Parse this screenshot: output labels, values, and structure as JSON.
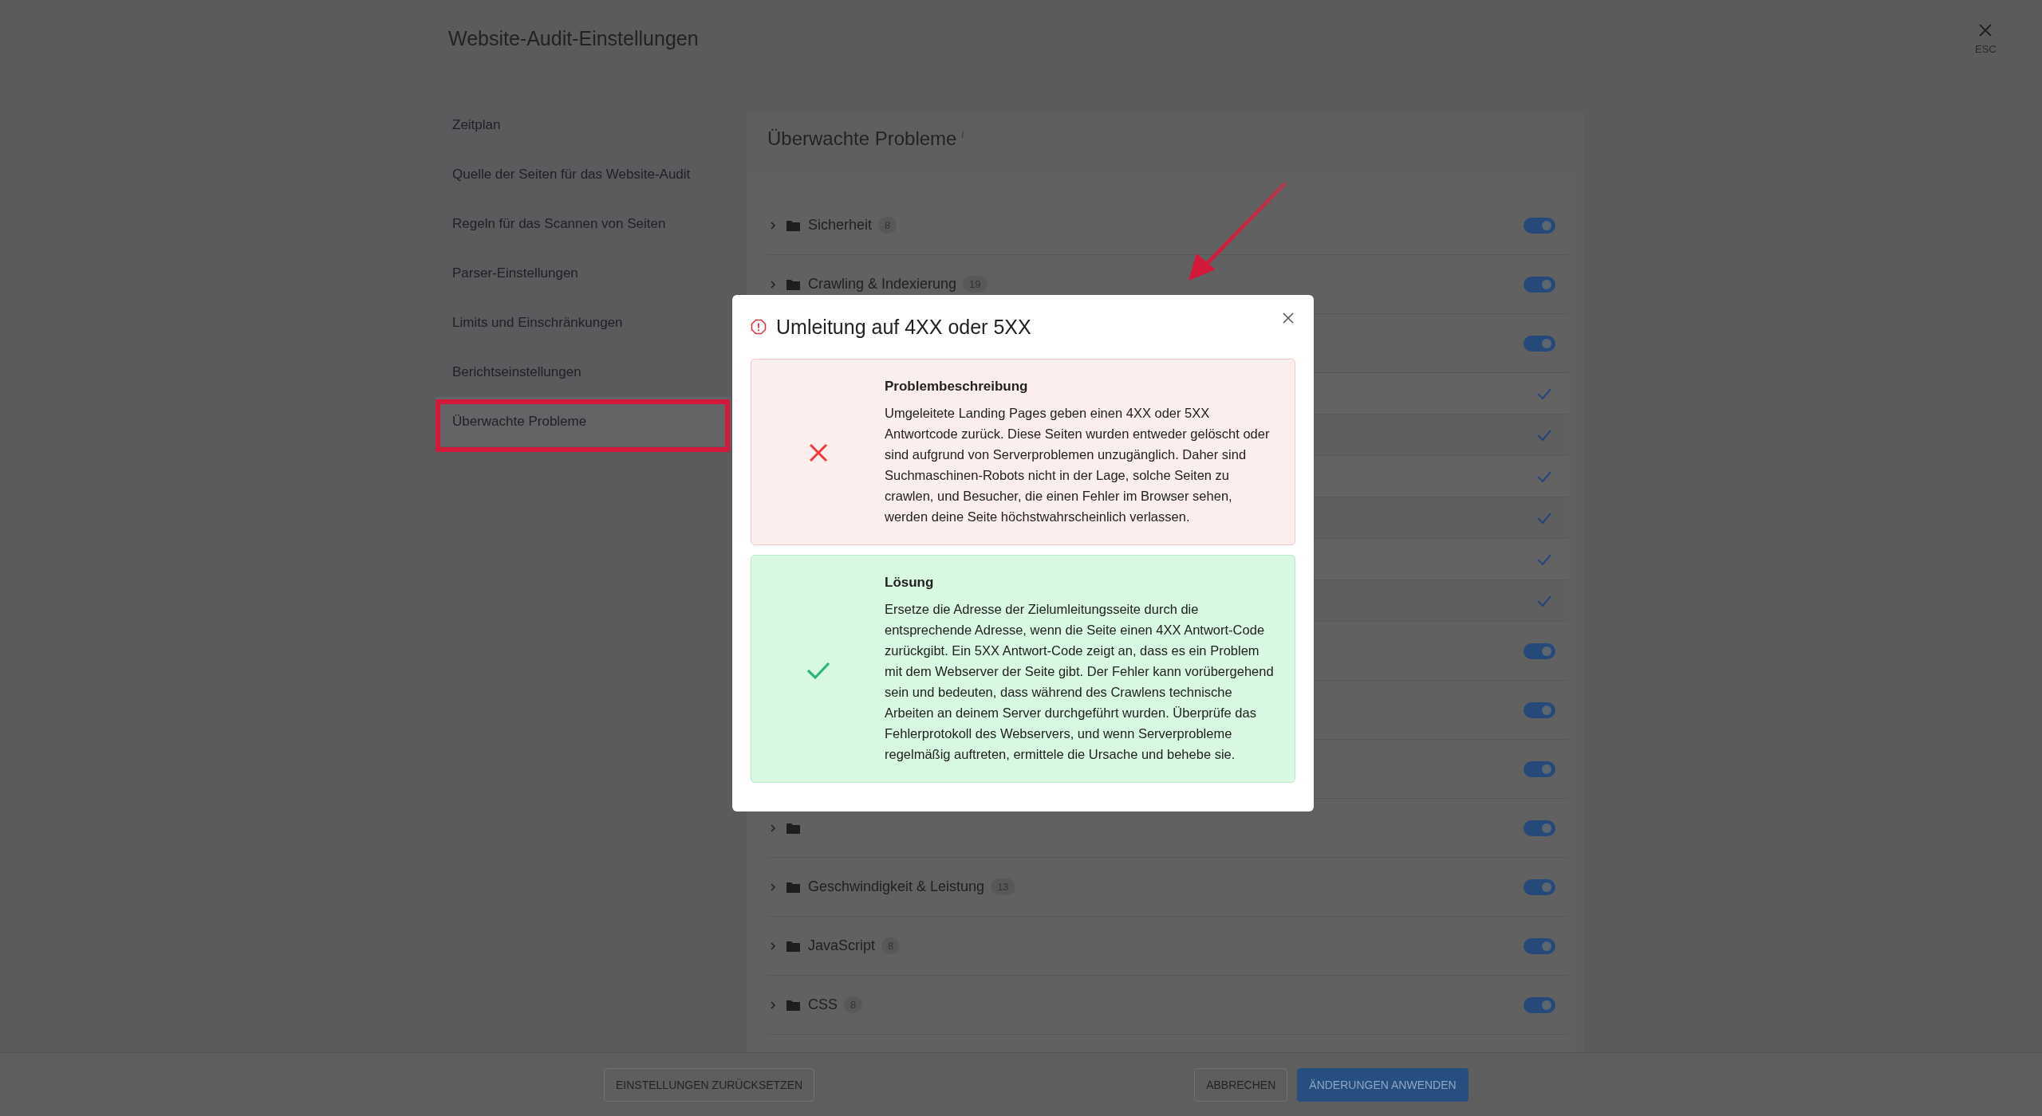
{
  "dialog_title": "Website-Audit-Einstellungen",
  "close_label": "ESC",
  "sidebar": {
    "items": [
      {
        "label": "Zeitplan",
        "selected": false
      },
      {
        "label": "Quelle der Seiten für das Website-Audit",
        "selected": false
      },
      {
        "label": "Regeln für das Scannen von Seiten",
        "selected": false
      },
      {
        "label": "Parser-Einstellungen",
        "selected": false
      },
      {
        "label": "Limits und Einschränkungen",
        "selected": false
      },
      {
        "label": "Berichtseinstellungen",
        "selected": false
      },
      {
        "label": "Überwachte Probleme",
        "selected": true
      }
    ]
  },
  "panel": {
    "title": "Überwachte Probleme",
    "info_mark": "i",
    "rows": [
      {
        "kind": "group",
        "label": "Sicherheit",
        "count": "8",
        "on": true
      },
      {
        "kind": "group",
        "label": "Crawling & Indexierung",
        "count": "19",
        "on": true
      },
      {
        "kind": "group",
        "on": true
      },
      {
        "kind": "issue",
        "checked": true
      },
      {
        "kind": "issue",
        "checked": true
      },
      {
        "kind": "issue",
        "checked": true
      },
      {
        "kind": "issue",
        "checked": true
      },
      {
        "kind": "issue",
        "checked": true
      },
      {
        "kind": "issue",
        "checked": true
      },
      {
        "kind": "group",
        "on": true
      },
      {
        "kind": "group",
        "on": true
      },
      {
        "kind": "group",
        "on": true
      },
      {
        "kind": "group",
        "on": true
      },
      {
        "kind": "group",
        "label": "Geschwindigkeit & Leistung",
        "count": "13",
        "on": true
      },
      {
        "kind": "group",
        "label": "JavaScript",
        "count": "8",
        "on": true
      },
      {
        "kind": "group",
        "label": "CSS",
        "count": "8",
        "on": true
      }
    ]
  },
  "modal": {
    "title": "Umleitung auf 4XX oder 5XX",
    "sections": [
      {
        "kind": "problem",
        "heading": "Problembeschreibung",
        "text": "Umgeleitete Landing Pages geben einen 4XX oder 5XX Antwortcode zurück. Diese Seiten wurden entweder gelöscht oder sind aufgrund von Serverproblemen unzugänglich. Daher sind Suchmaschinen-Robots nicht in der Lage, solche Seiten zu crawlen, und Besucher, die einen Fehler im Browser sehen, werden deine Seite höchstwahrscheinlich verlassen."
      },
      {
        "kind": "solution",
        "heading": "Lösung",
        "text": "Ersetze die Adresse der Zielumleitungsseite durch die entsprechende Adresse, wenn die Seite einen 4XX Antwort-Code zurückgibt. Ein 5XX Antwort-Code zeigt an, dass es ein Problem mit dem Webserver der Seite gibt. Der Fehler kann vorübergehend sein und bedeuten, dass während des Crawlens technische Arbeiten an deinem Server durchgeführt wurden. Überprüfe das Fehlerprotokoll des Webservers, und wenn Serverprobleme regelmäßig auftreten, ermittele die Ursache und behebe sie."
      }
    ]
  },
  "footer": {
    "buttons": [
      {
        "label": "EINSTELLUNGEN ZURÜCKSETZEN",
        "kind": "secondary"
      },
      {
        "label": "ABBRECHEN",
        "kind": "secondary"
      },
      {
        "label": "ÄNDERUNGEN ANWENDEN",
        "kind": "primary"
      }
    ]
  }
}
